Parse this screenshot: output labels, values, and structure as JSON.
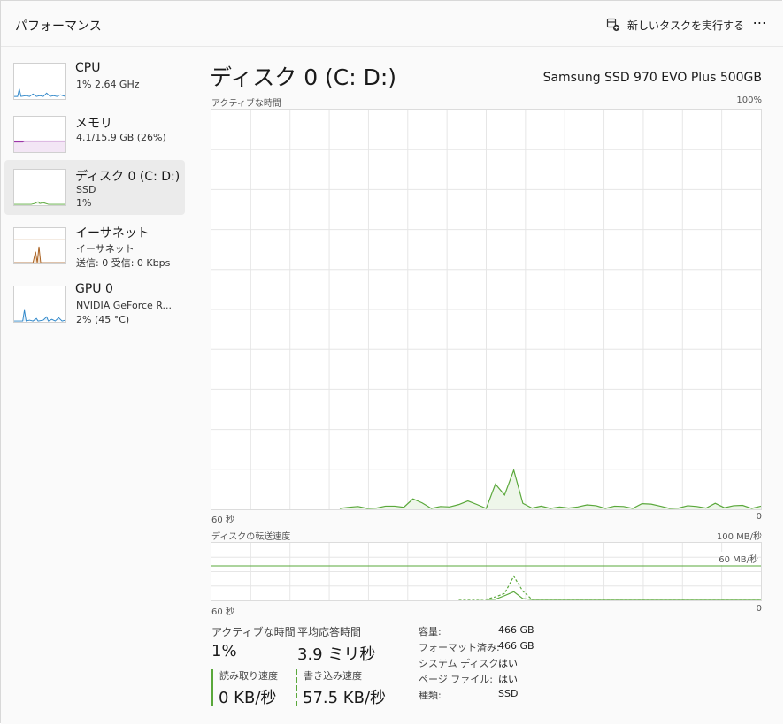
{
  "header": {
    "title": "パフォーマンス",
    "run_task_label": "新しいタスクを実行する",
    "more_label": "⋯"
  },
  "sidebar": {
    "items": [
      {
        "name": "CPU",
        "sub1": "1%  2.64 GHz",
        "sub2": "",
        "sub3": "",
        "graph_color": "#2f87c9"
      },
      {
        "name": "メモリ",
        "sub1": "4.1/15.9 GB (26%)",
        "sub2": "",
        "sub3": "",
        "graph_color": "#9b36a8"
      },
      {
        "name": "ディスク 0 (C: D:)",
        "sub1": "SSD",
        "sub2": "1%",
        "sub3": "",
        "graph_color": "#5aa83b"
      },
      {
        "name": "イーサネット",
        "sub1": "イーサネット",
        "sub2": "送信: 0  受信: 0 Kbps",
        "sub3": "",
        "graph_color": "#a85f1e"
      },
      {
        "name": "GPU 0",
        "sub1": "NVIDIA GeForce R...",
        "sub2": "2%  (45 °C)",
        "sub3": "",
        "graph_color": "#2f87c9"
      }
    ]
  },
  "main": {
    "title": "ディスク 0 (C: D:)",
    "model": "Samsung SSD 970 EVO Plus 500GB",
    "active_chart": {
      "label": "アクティブな時間",
      "max_label": "100%",
      "left_label": "60 秒",
      "right_label": "0"
    },
    "transfer_chart": {
      "label": "ディスクの転送速度",
      "max_label": "100 MB/秒",
      "ref_label": "60 MB/秒",
      "left_label": "60 秒",
      "right_label": "0"
    },
    "stats": {
      "active_label": "アクティブな時間",
      "active_value": "1%",
      "response_label": "平均応答時間",
      "response_value": "3.9 ミリ秒",
      "read_label": "読み取り速度",
      "read_value": "0 KB/秒",
      "write_label": "書き込み速度",
      "write_value": "57.5 KB/秒"
    },
    "properties": [
      {
        "key": "容量:",
        "value": "466 GB"
      },
      {
        "key": "フォーマット済み:",
        "value": "466 GB"
      },
      {
        "key": "システム ディスク:",
        "value": "はい"
      },
      {
        "key": "ページ ファイル:",
        "value": "はい"
      },
      {
        "key": "種類:",
        "value": "SSD"
      }
    ]
  },
  "colors": {
    "disk_accent": "#5aa83b",
    "disk_fill": "#eef6ea",
    "grid": "#e6e6e6"
  },
  "chart_data": [
    {
      "type": "area",
      "title": "アクティブな時間",
      "xlabel": "",
      "ylabel": "",
      "x_range_labels": [
        "60 秒",
        "0"
      ],
      "ylim": [
        0,
        100
      ],
      "y_unit": "%",
      "grid": true,
      "series": [
        {
          "values": [
            0,
            0,
            0,
            0,
            0,
            0,
            0,
            0,
            0,
            0,
            0,
            0,
            0,
            0,
            0,
            0.5,
            0.7,
            0.2,
            0.3,
            0.8,
            0.8,
            0.5,
            2.6,
            1.6,
            0.1,
            0.7,
            0.6,
            1.2,
            2.1,
            1.2,
            0.2,
            6.3,
            3.6,
            9.8,
            1.5,
            0.3,
            0.8,
            0.1,
            0.6,
            0.3,
            0.6,
            1.1,
            0.9,
            0.1,
            0.8,
            0.7,
            0.1,
            1.4,
            1.3,
            0.8,
            0.1,
            0.3,
            0.9,
            0.7,
            0.3,
            1.5,
            0.4,
            0.9,
            1.0,
            0.1,
            0.8
          ]
        }
      ]
    },
    {
      "type": "line",
      "title": "ディスクの転送速度",
      "xlabel": "",
      "ylabel": "",
      "x_range_labels": [
        "60 秒",
        "0"
      ],
      "ylim": [
        0,
        100
      ],
      "y_unit": "MB/秒",
      "reference_line": 60,
      "grid": true,
      "series": [
        {
          "style": "solid",
          "values": [
            0,
            0,
            0,
            0,
            0,
            0,
            0,
            0,
            0,
            0,
            0,
            0,
            0,
            0,
            0,
            0,
            0,
            0,
            0,
            0,
            0,
            0,
            0,
            0,
            0,
            0,
            0,
            0,
            0,
            0,
            0,
            2,
            8,
            15,
            3,
            0,
            0,
            0,
            0,
            0,
            0,
            0,
            0,
            0,
            0,
            0,
            0,
            0,
            0,
            0,
            0,
            0,
            0,
            0,
            0,
            0,
            0,
            0,
            0,
            0,
            0
          ]
        },
        {
          "style": "dashed",
          "values": [
            0,
            0,
            0,
            0,
            0,
            0,
            0,
            0,
            0,
            0,
            0,
            0,
            0,
            0,
            0,
            0,
            0,
            0,
            0,
            0,
            0,
            0,
            0,
            0,
            0,
            0,
            0,
            0,
            0.5,
            0.5,
            2,
            6,
            12,
            42,
            16,
            0,
            0,
            0,
            0,
            0,
            0,
            0,
            0,
            0,
            0,
            0,
            0,
            0,
            0,
            0,
            0,
            0,
            0,
            0,
            0,
            0,
            0,
            0,
            0,
            0,
            0
          ]
        }
      ]
    }
  ]
}
